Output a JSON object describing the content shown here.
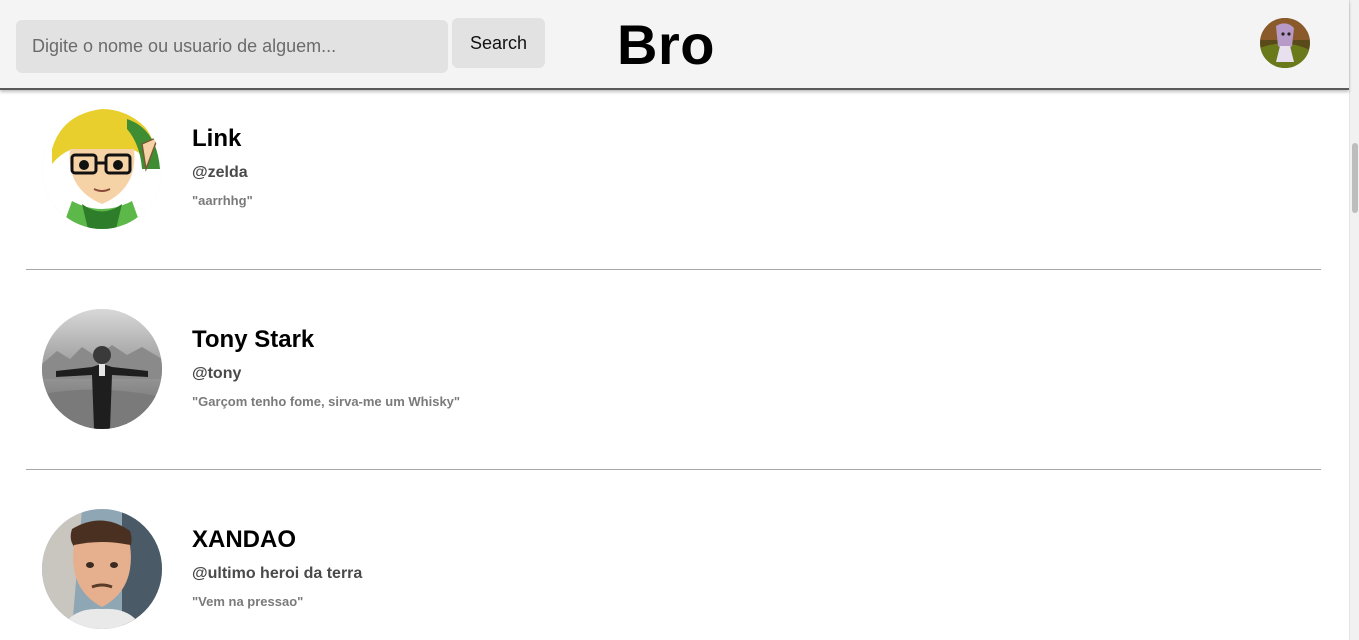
{
  "header": {
    "search_placeholder": "Digite o nome ou usuario de alguem...",
    "search_value": "",
    "search_button_label": "Search",
    "brand": "Bro",
    "profile_avatar_icon": "user-avatar-photo"
  },
  "users": [
    {
      "name": "Link",
      "handle": "@zelda",
      "quote": "\"aarrhhg\"",
      "avatar_icon": "cartoon-elf-avatar"
    },
    {
      "name": "Tony Stark",
      "handle": "@tony",
      "quote": "\"Garçom tenho fome, sirva-me um Whisky\"",
      "avatar_icon": "grayscale-photo-avatar"
    },
    {
      "name": "XANDAO",
      "handle": "@ultimo heroi da terra",
      "quote": "\"Vem na pressao\"",
      "avatar_icon": "selfie-photo-avatar"
    }
  ],
  "colors": {
    "header_bg": "#f4f4f4",
    "input_bg": "#e2e2e2",
    "divider": "#a8a8a8",
    "handle_text": "#4a4a4a",
    "quote_text": "#7a7a7a"
  }
}
